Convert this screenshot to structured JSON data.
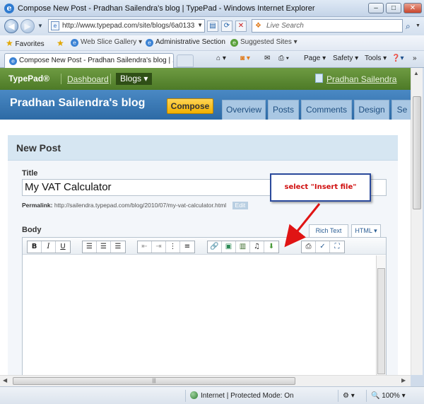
{
  "window": {
    "title": "Compose New Post - Pradhan Sailendra's blog | TypePad - Windows Internet Explorer"
  },
  "address": {
    "url": "http://www.typepad.com/site/blogs/6a0133"
  },
  "search": {
    "placeholder": "Live Search"
  },
  "favorites": {
    "label": "Favorites",
    "items": [
      "Web Slice Gallery",
      "Administrative Section",
      "Suggested Sites"
    ]
  },
  "tab": {
    "title": "Compose New Post - Pradhan Sailendra's blog | ..."
  },
  "commandbar": {
    "page": "Page",
    "safety": "Safety",
    "tools": "Tools"
  },
  "typepad": {
    "logo": "TypePad®",
    "dashboard": "Dashboard",
    "blogs": "Blogs",
    "user": "Pradhan Sailendra",
    "blog_title": "Pradhan Sailendra's blog",
    "compose": "Compose",
    "nav": [
      "Overview",
      "Posts",
      "Comments",
      "Design",
      "Se"
    ]
  },
  "post": {
    "heading": "New Post",
    "title_label": "Title",
    "title_value": "My VAT Calculator",
    "permalink_label": "Permalink:",
    "permalink_url": "http://sailendra.typepad.com/blog/2010/07/my-vat-calculator.html",
    "edit_label": "Edit",
    "body_label": "Body",
    "rich_text": "Rich Text",
    "html_tab": "HTML"
  },
  "callout": {
    "text": "select \"Insert file\""
  },
  "status": {
    "zone": "Internet | Protected Mode: On",
    "zoom": "100%"
  },
  "colors": {
    "typepad_green": "#5a8a30",
    "blog_blue": "#3a7ab8",
    "compose_yellow": "#f7c21a",
    "callout_red": "#d01010"
  }
}
